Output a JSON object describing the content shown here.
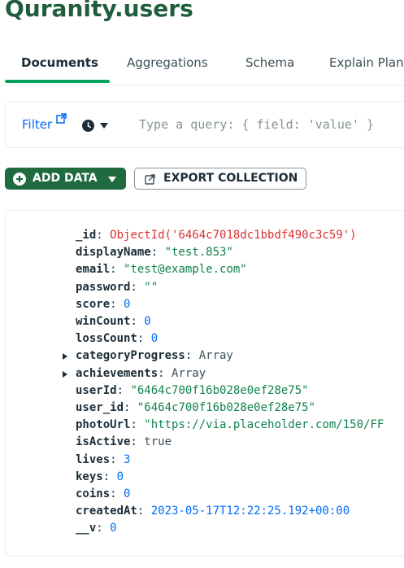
{
  "collection": {
    "title": "Quranity.users"
  },
  "tabs": [
    {
      "label": "Documents"
    },
    {
      "label": "Aggregations"
    },
    {
      "label": "Schema"
    },
    {
      "label": "Explain Plan"
    }
  ],
  "filter": {
    "label": "Filter",
    "placeholder": "Type a query: { field: 'value' }"
  },
  "toolbar": {
    "add_data_label": "ADD DATA",
    "export_label": "EXPORT COLLECTION"
  },
  "document": {
    "fields": [
      {
        "key": "_id",
        "sep": ": ",
        "value": "ObjectId('6464c7018dc1bbdf490c3c59')",
        "type": "oid"
      },
      {
        "key": "displayName",
        "sep": ": ",
        "value": "\"test.853\"",
        "type": "str"
      },
      {
        "key": "email",
        "sep": ": ",
        "value": "\"test@example.com\"",
        "type": "str"
      },
      {
        "key": "password",
        "sep": ": ",
        "value": "\"\"",
        "type": "str"
      },
      {
        "key": "score",
        "sep": ": ",
        "value": "0",
        "type": "num"
      },
      {
        "key": "winCount",
        "sep": ": ",
        "value": "0",
        "type": "num"
      },
      {
        "key": "lossCount",
        "sep": ": ",
        "value": "0",
        "type": "num"
      },
      {
        "key": "categoryProgress",
        "sep": ": ",
        "value": "Array",
        "type": "plain",
        "expandable": true
      },
      {
        "key": "achievements",
        "sep": ": ",
        "value": "Array",
        "type": "plain",
        "expandable": true
      },
      {
        "key": "userId",
        "sep": ": ",
        "value": "\"6464c700f16b028e0ef28e75\"",
        "type": "str"
      },
      {
        "key": "user_id",
        "sep": ": ",
        "value": "\"6464c700f16b028e0ef28e75\"",
        "type": "str"
      },
      {
        "key": "photoUrl",
        "sep": ": ",
        "value": "\"https://via.placeholder.com/150/FF",
        "type": "str"
      },
      {
        "key": "isActive",
        "sep": ": ",
        "value": "true",
        "type": "plain"
      },
      {
        "key": "lives",
        "sep": ": ",
        "value": "3",
        "type": "num"
      },
      {
        "key": "keys",
        "sep": ": ",
        "value": "0",
        "type": "num"
      },
      {
        "key": "coins",
        "sep": ": ",
        "value": "0",
        "type": "num"
      },
      {
        "key": "createdAt",
        "sep": ": ",
        "value": "2023-05-17T12:22:25.192+00:00",
        "type": "num"
      },
      {
        "key": "__v",
        "sep": ": ",
        "value": "0",
        "type": "num"
      }
    ]
  },
  "icons": {
    "filter_external": "external-link-icon",
    "history": "clock-icon",
    "history_caret": "chevron-down-icon",
    "add_data": "plus-circle-icon",
    "add_data_caret": "chevron-down-icon",
    "export": "export-icon",
    "expand": "caret-right-icon"
  },
  "colors": {
    "title": "#1f5d3c",
    "tab_active_underline": "#00a35c",
    "link": "#016bf8",
    "add_data_bg": "#1f6b3f",
    "objectid": "#db3030",
    "string": "#12824d",
    "number": "#016bf8"
  }
}
